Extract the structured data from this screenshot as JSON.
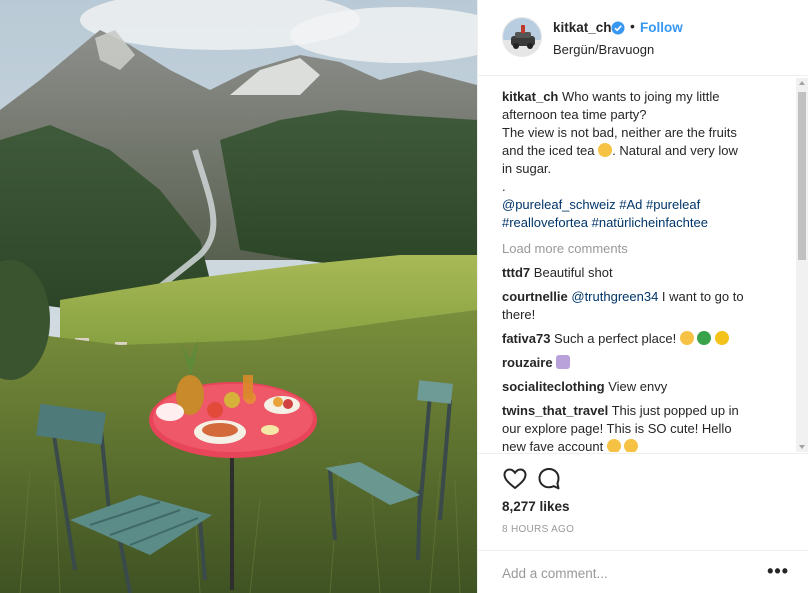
{
  "post": {
    "username": "kitkat_ch",
    "follow_label": "Follow",
    "separator": "•",
    "location": "Bergün/Bravuogn",
    "caption_user": "kitkat_ch",
    "caption_lines": [
      "Who wants to joing my little",
      "afternoon tea time party?",
      "The view is not bad, neither are the fruits",
      "and the iced tea",
      ". Natural and very low",
      "in sugar.",
      "."
    ],
    "hashtags_line1": "@pureleaf_schweiz #Ad #pureleaf",
    "hashtags_line2": "#realloveforteа #natürlicheinfachtee",
    "load_more": "Load more comments",
    "comments": [
      {
        "user": "tttd7",
        "text": "Beautiful shot"
      },
      {
        "user": "courtnellie",
        "mention": "@truthgreen34",
        "text": "I want to go to",
        "text2": "there!"
      },
      {
        "user": "fativa73",
        "text": "Such a perfect place!"
      },
      {
        "user": "rouzaire",
        "text": ""
      },
      {
        "user": "socialiteclothing",
        "text": "View envy"
      },
      {
        "user": "twins_that_travel",
        "text": "This just popped up in",
        "text2": "our explore page! This is SO cute! Hello",
        "text3": "new fave account"
      }
    ],
    "likes": "8,277 likes",
    "time": "8 HOURS AGO",
    "comment_placeholder": "Add a comment...",
    "more_label": "•••"
  },
  "colors": {
    "link": "#003569",
    "follow": "#3897f0",
    "muted": "#999999",
    "table": "#e8455a"
  },
  "icons": [
    "verified-badge-icon",
    "heart-icon",
    "comment-icon",
    "more-options-icon"
  ]
}
